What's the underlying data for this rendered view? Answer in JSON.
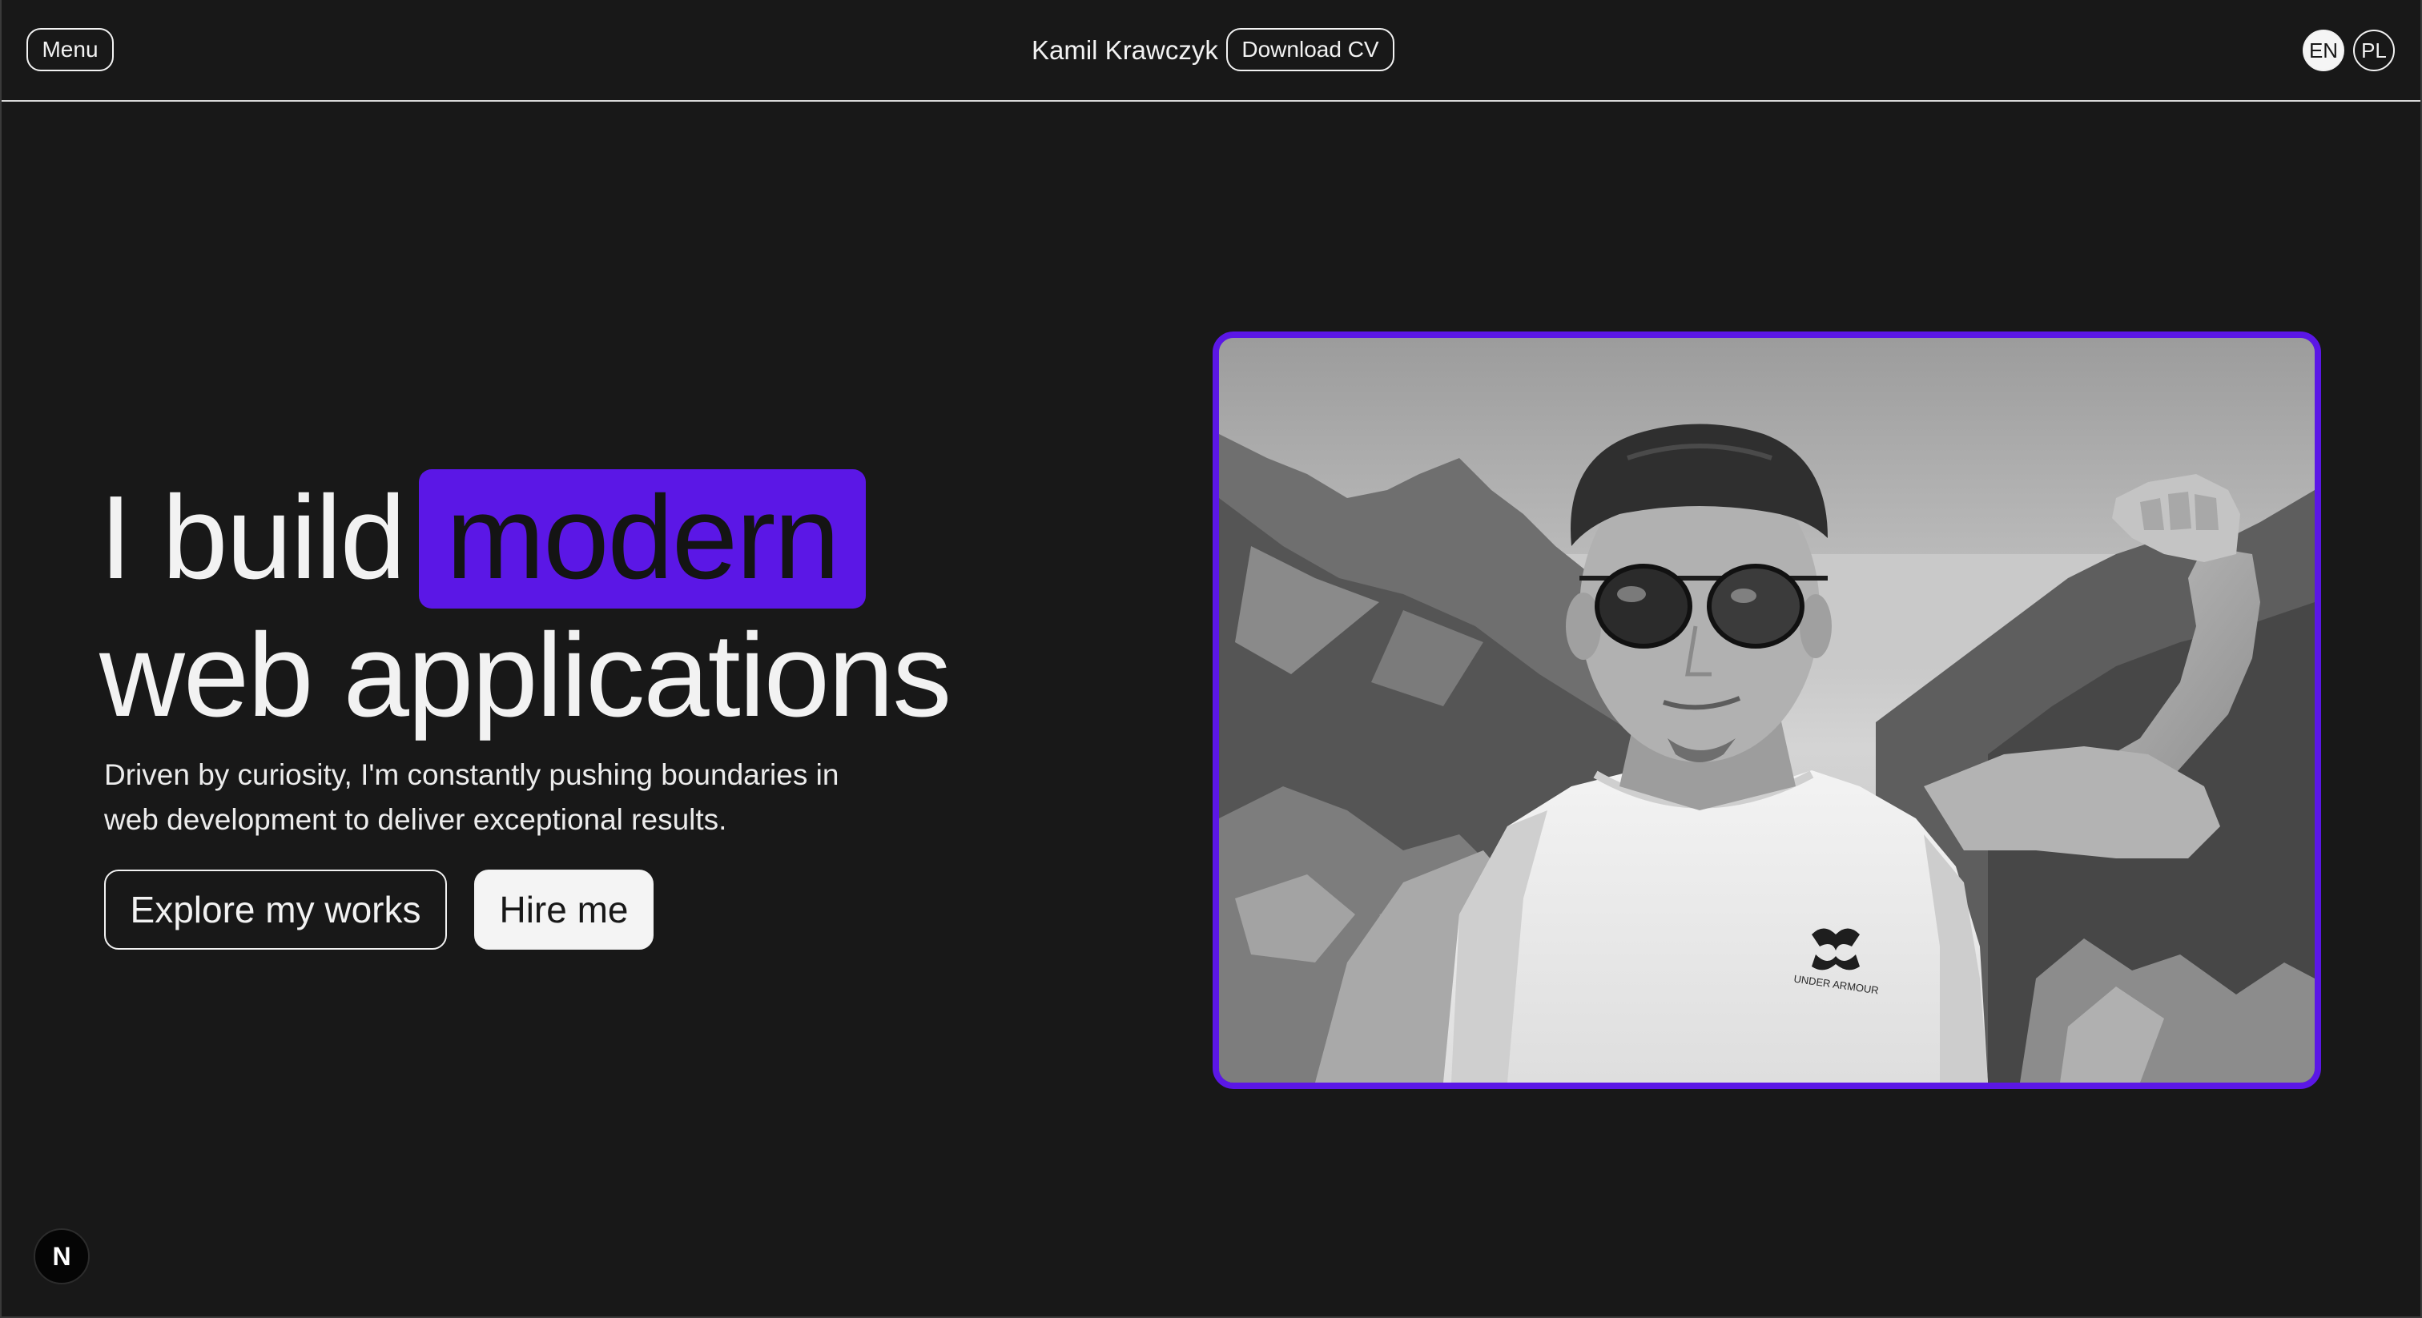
{
  "header": {
    "menu_label": "Menu",
    "name": "Kamil Krawczyk",
    "cv_label": "Download CV",
    "languages": [
      {
        "code": "EN",
        "active": true
      },
      {
        "code": "PL",
        "active": false
      }
    ]
  },
  "hero": {
    "headline_prefix": "I build",
    "headline_highlight": "modern",
    "headline_line2": "web applications",
    "subtitle": "Driven by curiosity, I'm constantly pushing boundaries in web development to deliver exceptional results.",
    "primary_cta": "Explore my works",
    "secondary_cta": "Hire me"
  },
  "photo": {
    "brand_text": "UNDER ARMOUR"
  },
  "floating_badge": {
    "icon": "nextjs-n-icon",
    "glyph": "N"
  },
  "colors": {
    "background": "#181818",
    "accent": "#5b17e6",
    "text": "#f2f2f2"
  }
}
